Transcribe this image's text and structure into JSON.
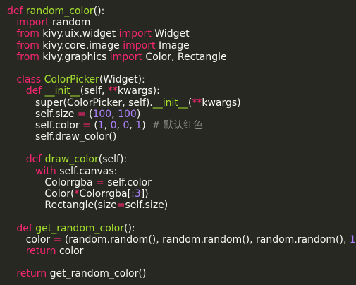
{
  "code": {
    "lines": [
      [
        {
          "t": "def ",
          "c": "k"
        },
        {
          "t": "random_color",
          "c": "f"
        },
        {
          "t": "():",
          "c": "t"
        }
      ],
      [
        {
          "t": "   import ",
          "c": "k"
        },
        {
          "t": "random",
          "c": "t"
        }
      ],
      [
        {
          "t": "   from ",
          "c": "k"
        },
        {
          "t": "kivy.uix.widget ",
          "c": "t"
        },
        {
          "t": "import ",
          "c": "k"
        },
        {
          "t": "Widget",
          "c": "t"
        }
      ],
      [
        {
          "t": "   from ",
          "c": "k"
        },
        {
          "t": "kivy.core.image ",
          "c": "t"
        },
        {
          "t": "import ",
          "c": "k"
        },
        {
          "t": "Image",
          "c": "t"
        }
      ],
      [
        {
          "t": "   from ",
          "c": "k"
        },
        {
          "t": "kivy.graphics ",
          "c": "t"
        },
        {
          "t": "import ",
          "c": "k"
        },
        {
          "t": "Color, Rectangle",
          "c": "t"
        }
      ],
      [],
      [
        {
          "t": "   class ",
          "c": "k"
        },
        {
          "t": "ColorPicker",
          "c": "f"
        },
        {
          "t": "(Widget):",
          "c": "t"
        }
      ],
      [
        {
          "t": "      def ",
          "c": "k"
        },
        {
          "t": "__init__",
          "c": "f"
        },
        {
          "t": "(self, ",
          "c": "t"
        },
        {
          "t": "**",
          "c": "k"
        },
        {
          "t": "kwargs):",
          "c": "t"
        }
      ],
      [
        {
          "t": "         super(ColorPicker, self).",
          "c": "t"
        },
        {
          "t": "__init__",
          "c": "f"
        },
        {
          "t": "(",
          "c": "t"
        },
        {
          "t": "**",
          "c": "k"
        },
        {
          "t": "kwargs)",
          "c": "t"
        }
      ],
      [
        {
          "t": "         self.size ",
          "c": "t"
        },
        {
          "t": "= ",
          "c": "k"
        },
        {
          "t": "(",
          "c": "t"
        },
        {
          "t": "100",
          "c": "n"
        },
        {
          "t": ", ",
          "c": "t"
        },
        {
          "t": "100",
          "c": "n"
        },
        {
          "t": ")",
          "c": "t"
        }
      ],
      [
        {
          "t": "         self.color ",
          "c": "t"
        },
        {
          "t": "= ",
          "c": "k"
        },
        {
          "t": "(",
          "c": "t"
        },
        {
          "t": "1",
          "c": "n"
        },
        {
          "t": ", ",
          "c": "t"
        },
        {
          "t": "0",
          "c": "n"
        },
        {
          "t": ", ",
          "c": "t"
        },
        {
          "t": "0",
          "c": "n"
        },
        {
          "t": ", ",
          "c": "t"
        },
        {
          "t": "1",
          "c": "n"
        },
        {
          "t": ")  ",
          "c": "t"
        },
        {
          "t": "# 默认红色",
          "c": "c"
        }
      ],
      [
        {
          "t": "         self.draw_color()",
          "c": "t"
        }
      ],
      [],
      [
        {
          "t": "      def ",
          "c": "k"
        },
        {
          "t": "draw_color",
          "c": "f"
        },
        {
          "t": "(self):",
          "c": "t"
        }
      ],
      [
        {
          "t": "         with ",
          "c": "k"
        },
        {
          "t": "self.canvas:",
          "c": "t"
        }
      ],
      [
        {
          "t": "            Colorrgba ",
          "c": "t"
        },
        {
          "t": "= ",
          "c": "k"
        },
        {
          "t": "self.color",
          "c": "t"
        }
      ],
      [
        {
          "t": "            Color(",
          "c": "t"
        },
        {
          "t": "*",
          "c": "k"
        },
        {
          "t": "Colorrgba[",
          "c": "t"
        },
        {
          "t": ":3",
          "c": "n"
        },
        {
          "t": "])",
          "c": "t"
        }
      ],
      [
        {
          "t": "            Rectangle(size",
          "c": "t"
        },
        {
          "t": "=",
          "c": "k"
        },
        {
          "t": "self.size)",
          "c": "t"
        }
      ],
      [],
      [
        {
          "t": "   def ",
          "c": "k"
        },
        {
          "t": "get_random_color",
          "c": "f"
        },
        {
          "t": "():",
          "c": "t"
        }
      ],
      [
        {
          "t": "      color ",
          "c": "t"
        },
        {
          "t": "= ",
          "c": "k"
        },
        {
          "t": "(random.random(), random.random(), random.random(), ",
          "c": "t"
        },
        {
          "t": "1",
          "c": "n"
        },
        {
          "t": ")",
          "c": "t"
        }
      ],
      [
        {
          "t": "      return ",
          "c": "k"
        },
        {
          "t": "color",
          "c": "t"
        }
      ],
      [],
      [
        {
          "t": "   return ",
          "c": "k"
        },
        {
          "t": "get_random_color()",
          "c": "t"
        }
      ]
    ]
  }
}
